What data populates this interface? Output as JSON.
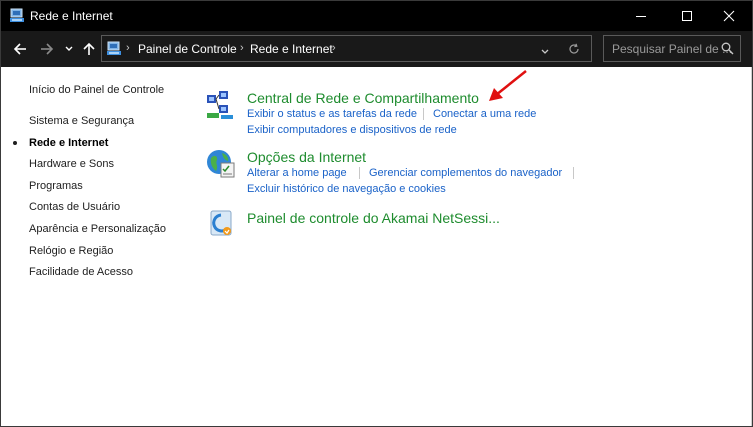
{
  "window": {
    "title": "Rede e Internet",
    "icon": "control-panel-icon"
  },
  "navigation": {
    "breadcrumbs": [
      "Painel de Controle",
      "Rede e Internet"
    ],
    "search_placeholder": "Pesquisar Painel de ..."
  },
  "sidebar": {
    "items": [
      {
        "label": "Início do Painel de Controle",
        "current": false
      },
      {
        "label": "Sistema e Segurança",
        "current": false
      },
      {
        "label": "Rede e Internet",
        "current": true
      },
      {
        "label": "Hardware e Sons",
        "current": false
      },
      {
        "label": "Programas",
        "current": false
      },
      {
        "label": "Contas de Usuário",
        "current": false
      },
      {
        "label": "Aparência e Personalização",
        "current": false
      },
      {
        "label": "Relógio e Região",
        "current": false
      },
      {
        "label": "Facilidade de Acesso",
        "current": false
      }
    ]
  },
  "categories": [
    {
      "heading": "Central de Rede e Compartilhamento",
      "icon": "network-sharing-center-icon",
      "links": [
        "Exibir o status e as tarefas da rede",
        "Conectar a uma rede",
        "Exibir computadores e dispositivos de rede"
      ]
    },
    {
      "heading": "Opções da Internet",
      "icon": "internet-options-icon",
      "links": [
        "Alterar a home page",
        "Gerenciar complementos do navegador",
        "Excluir histórico de navegação e cookies"
      ]
    },
    {
      "heading": "Painel de controle do Akamai NetSessi...",
      "icon": "akamai-netsession-icon",
      "links": []
    }
  ],
  "colors": {
    "heading_green": "#1e8c2e",
    "link_blue": "#1a62c8",
    "annotation_arrow": "#e01010"
  }
}
